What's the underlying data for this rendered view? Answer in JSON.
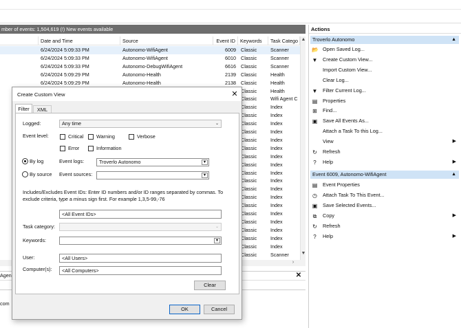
{
  "events_header": "mber of events: 1,504,619 (!) New events available",
  "columns": [
    "Date and Time",
    "Source",
    "Event ID",
    "Keywords",
    "Task Catego"
  ],
  "rows": [
    {
      "date": "6/24/2024 5:09:33 PM",
      "source": "Autonomo-WifiAgent",
      "id": "6009",
      "kw": "Classic",
      "task": "Scanner",
      "selected": true
    },
    {
      "date": "6/24/2024 5:09:33 PM",
      "source": "Autonomo-WifiAgent",
      "id": "6010",
      "kw": "Classic",
      "task": "Scanner"
    },
    {
      "date": "6/24/2024 5:09:33 PM",
      "source": "Autonomo-DebugWifiAgent",
      "id": "6616",
      "kw": "Classic",
      "task": "Scanner"
    },
    {
      "date": "6/24/2024 5:09:29 PM",
      "source": "Autonomo-Health",
      "id": "2139",
      "kw": "Classic",
      "task": "Health"
    },
    {
      "date": "6/24/2024 5:09:29 PM",
      "source": "Autonomo-Health",
      "id": "2138",
      "kw": "Classic",
      "task": "Health"
    },
    {
      "date": "",
      "source": "",
      "id": "",
      "kw": "Classic",
      "task": "Health"
    },
    {
      "date": "",
      "source": "",
      "id": "",
      "kw": "Classic",
      "task": "Wifi Agent C"
    },
    {
      "date": "",
      "source": "",
      "id": "",
      "kw": "Classic",
      "task": "Index"
    },
    {
      "date": "",
      "source": "",
      "id": "",
      "kw": "Classic",
      "task": "Index"
    },
    {
      "date": "",
      "source": "",
      "id": "",
      "kw": "Classic",
      "task": "Index"
    },
    {
      "date": "",
      "source": "",
      "id": "",
      "kw": "Classic",
      "task": "Index"
    },
    {
      "date": "",
      "source": "",
      "id": "",
      "kw": "Classic",
      "task": "Index"
    },
    {
      "date": "",
      "source": "",
      "id": "",
      "kw": "Classic",
      "task": "Index"
    },
    {
      "date": "",
      "source": "",
      "id": "",
      "kw": "Classic",
      "task": "Index"
    },
    {
      "date": "",
      "source": "",
      "id": "",
      "kw": "Classic",
      "task": "Index"
    },
    {
      "date": "",
      "source": "",
      "id": "",
      "kw": "Classic",
      "task": "Index"
    },
    {
      "date": "",
      "source": "",
      "id": "",
      "kw": "Classic",
      "task": "Index"
    },
    {
      "date": "",
      "source": "",
      "id": "",
      "kw": "Classic",
      "task": "Index"
    },
    {
      "date": "",
      "source": "",
      "id": "",
      "kw": "Classic",
      "task": "Index"
    },
    {
      "date": "",
      "source": "",
      "id": "",
      "kw": "Classic",
      "task": "Index"
    },
    {
      "date": "",
      "source": "",
      "id": "",
      "kw": "Classic",
      "task": "Index"
    },
    {
      "date": "",
      "source": "",
      "id": "",
      "kw": "Classic",
      "task": "Index"
    },
    {
      "date": "",
      "source": "",
      "id": "",
      "kw": "Classic",
      "task": "Index"
    },
    {
      "date": "",
      "source": "",
      "id": "",
      "kw": "Classic",
      "task": "Index"
    },
    {
      "date": "",
      "source": "",
      "id": "",
      "kw": "Classic",
      "task": "Index"
    },
    {
      "date": "",
      "source": "",
      "id": "",
      "kw": "Classic",
      "task": "Scanner"
    },
    {
      "date": "",
      "source": "",
      "id": "",
      "kw": "Classic",
      "task": "Index"
    }
  ],
  "details": {
    "tab_fragment": "Agen",
    "text_fragment": "com"
  },
  "actions": {
    "title": "Actions",
    "section1": "Troverlo Autonomo",
    "items1": [
      {
        "label": "Open Saved Log...",
        "icon": "folder-icon",
        "glyph": "📂",
        "submenu": false
      },
      {
        "label": "Create Custom View...",
        "icon": "funnel-icon",
        "glyph": "▼",
        "submenu": false
      },
      {
        "label": "Import Custom View...",
        "icon": "",
        "glyph": "",
        "submenu": false
      },
      {
        "label": "Clear Log...",
        "icon": "",
        "glyph": "",
        "submenu": false
      },
      {
        "label": "Filter Current Log...",
        "icon": "funnel-icon",
        "glyph": "▼",
        "submenu": false
      },
      {
        "label": "Properties",
        "icon": "properties-icon",
        "glyph": "▤",
        "submenu": false
      },
      {
        "label": "Find...",
        "icon": "binoculars-icon",
        "glyph": "⊞",
        "submenu": false
      },
      {
        "label": "Save All Events As...",
        "icon": "save-icon",
        "glyph": "▣",
        "submenu": false
      },
      {
        "label": "Attach a Task To this Log...",
        "icon": "",
        "glyph": "",
        "submenu": false
      },
      {
        "label": "View",
        "icon": "",
        "glyph": "",
        "submenu": true
      },
      {
        "label": "Refresh",
        "icon": "refresh-icon",
        "glyph": "↻",
        "submenu": false
      },
      {
        "label": "Help",
        "icon": "help-icon",
        "glyph": "?",
        "submenu": true
      }
    ],
    "section2": "Event 6009, Autonomo-WifiAgent",
    "items2": [
      {
        "label": "Event Properties",
        "icon": "event-properties-icon",
        "glyph": "▤",
        "submenu": false
      },
      {
        "label": "Attach Task To This Event...",
        "icon": "task-icon",
        "glyph": "◷",
        "submenu": false
      },
      {
        "label": "Save Selected Events...",
        "icon": "save-icon",
        "glyph": "▣",
        "submenu": false
      },
      {
        "label": "Copy",
        "icon": "copy-icon",
        "glyph": "⧉",
        "submenu": true
      },
      {
        "label": "Refresh",
        "icon": "refresh-icon",
        "glyph": "↻",
        "submenu": false
      },
      {
        "label": "Help",
        "icon": "help-icon",
        "glyph": "?",
        "submenu": true
      }
    ]
  },
  "dialog": {
    "title": "Create Custom View",
    "tab_filter": "Filter",
    "tab_xml": "XML",
    "logged_label": "Logged:",
    "logged_value": "Any time",
    "event_level_label": "Event level:",
    "levels": {
      "critical": "Critical",
      "warning": "Warning",
      "verbose": "Verbose",
      "error": "Error",
      "information": "Information"
    },
    "by_log": "By log",
    "by_source": "By source",
    "event_logs_label": "Event logs:",
    "event_logs_value": "Troverlo Autonomo",
    "event_sources_label": "Event sources:",
    "event_sources_value": "",
    "hint": "Includes/Excludes Event IDs: Enter ID numbers and/or ID ranges separated by commas. To exclude criteria, type a minus sign first. For example 1,3,5-99,-76",
    "event_ids_value": "<All Event IDs>",
    "task_category_label": "Task category:",
    "keywords_label": "Keywords:",
    "user_label": "User:",
    "user_value": "<All Users>",
    "computers_label": "Computer(s):",
    "computers_value": "<All Computers>",
    "clear": "Clear",
    "ok": "OK",
    "cancel": "Cancel"
  }
}
